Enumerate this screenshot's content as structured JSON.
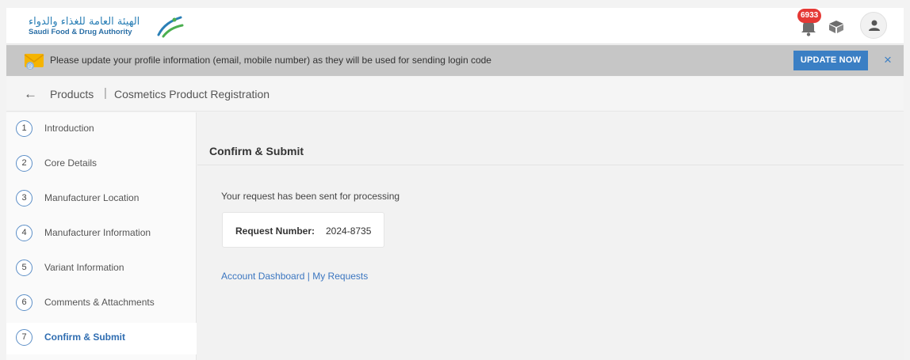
{
  "header": {
    "logo_ar": "الهيئة العامة للغذاء والدواء",
    "logo_en": "Saudi Food & Drug Authority",
    "notification_count": "6933"
  },
  "notice": {
    "message": "Please update your profile information (email, mobile number) as they will be used for sending login code",
    "button": "UPDATE NOW",
    "close": "×"
  },
  "breadcrumb": {
    "back": "←",
    "items": [
      "Products",
      "Cosmetics Product Registration"
    ],
    "separator": "|"
  },
  "sidebar": {
    "steps": [
      {
        "num": "1",
        "label": "Introduction"
      },
      {
        "num": "2",
        "label": "Core Details"
      },
      {
        "num": "3",
        "label": "Manufacturer Location"
      },
      {
        "num": "4",
        "label": "Manufacturer Information"
      },
      {
        "num": "5",
        "label": "Variant Information"
      },
      {
        "num": "6",
        "label": "Comments & Attachments"
      },
      {
        "num": "7",
        "label": "Confirm & Submit"
      }
    ],
    "active_step": "7"
  },
  "main": {
    "title": "Confirm & Submit",
    "status": "Your request has been sent for processing",
    "request_label": "Request Number:",
    "request_number": "2024-8735",
    "link_dashboard": "Account Dashboard",
    "link_sep": "|",
    "link_requests": "My Requests"
  },
  "colors": {
    "accent": "#3b7fc4",
    "badge": "#e53935",
    "notice_bg": "#c6c6c6"
  }
}
